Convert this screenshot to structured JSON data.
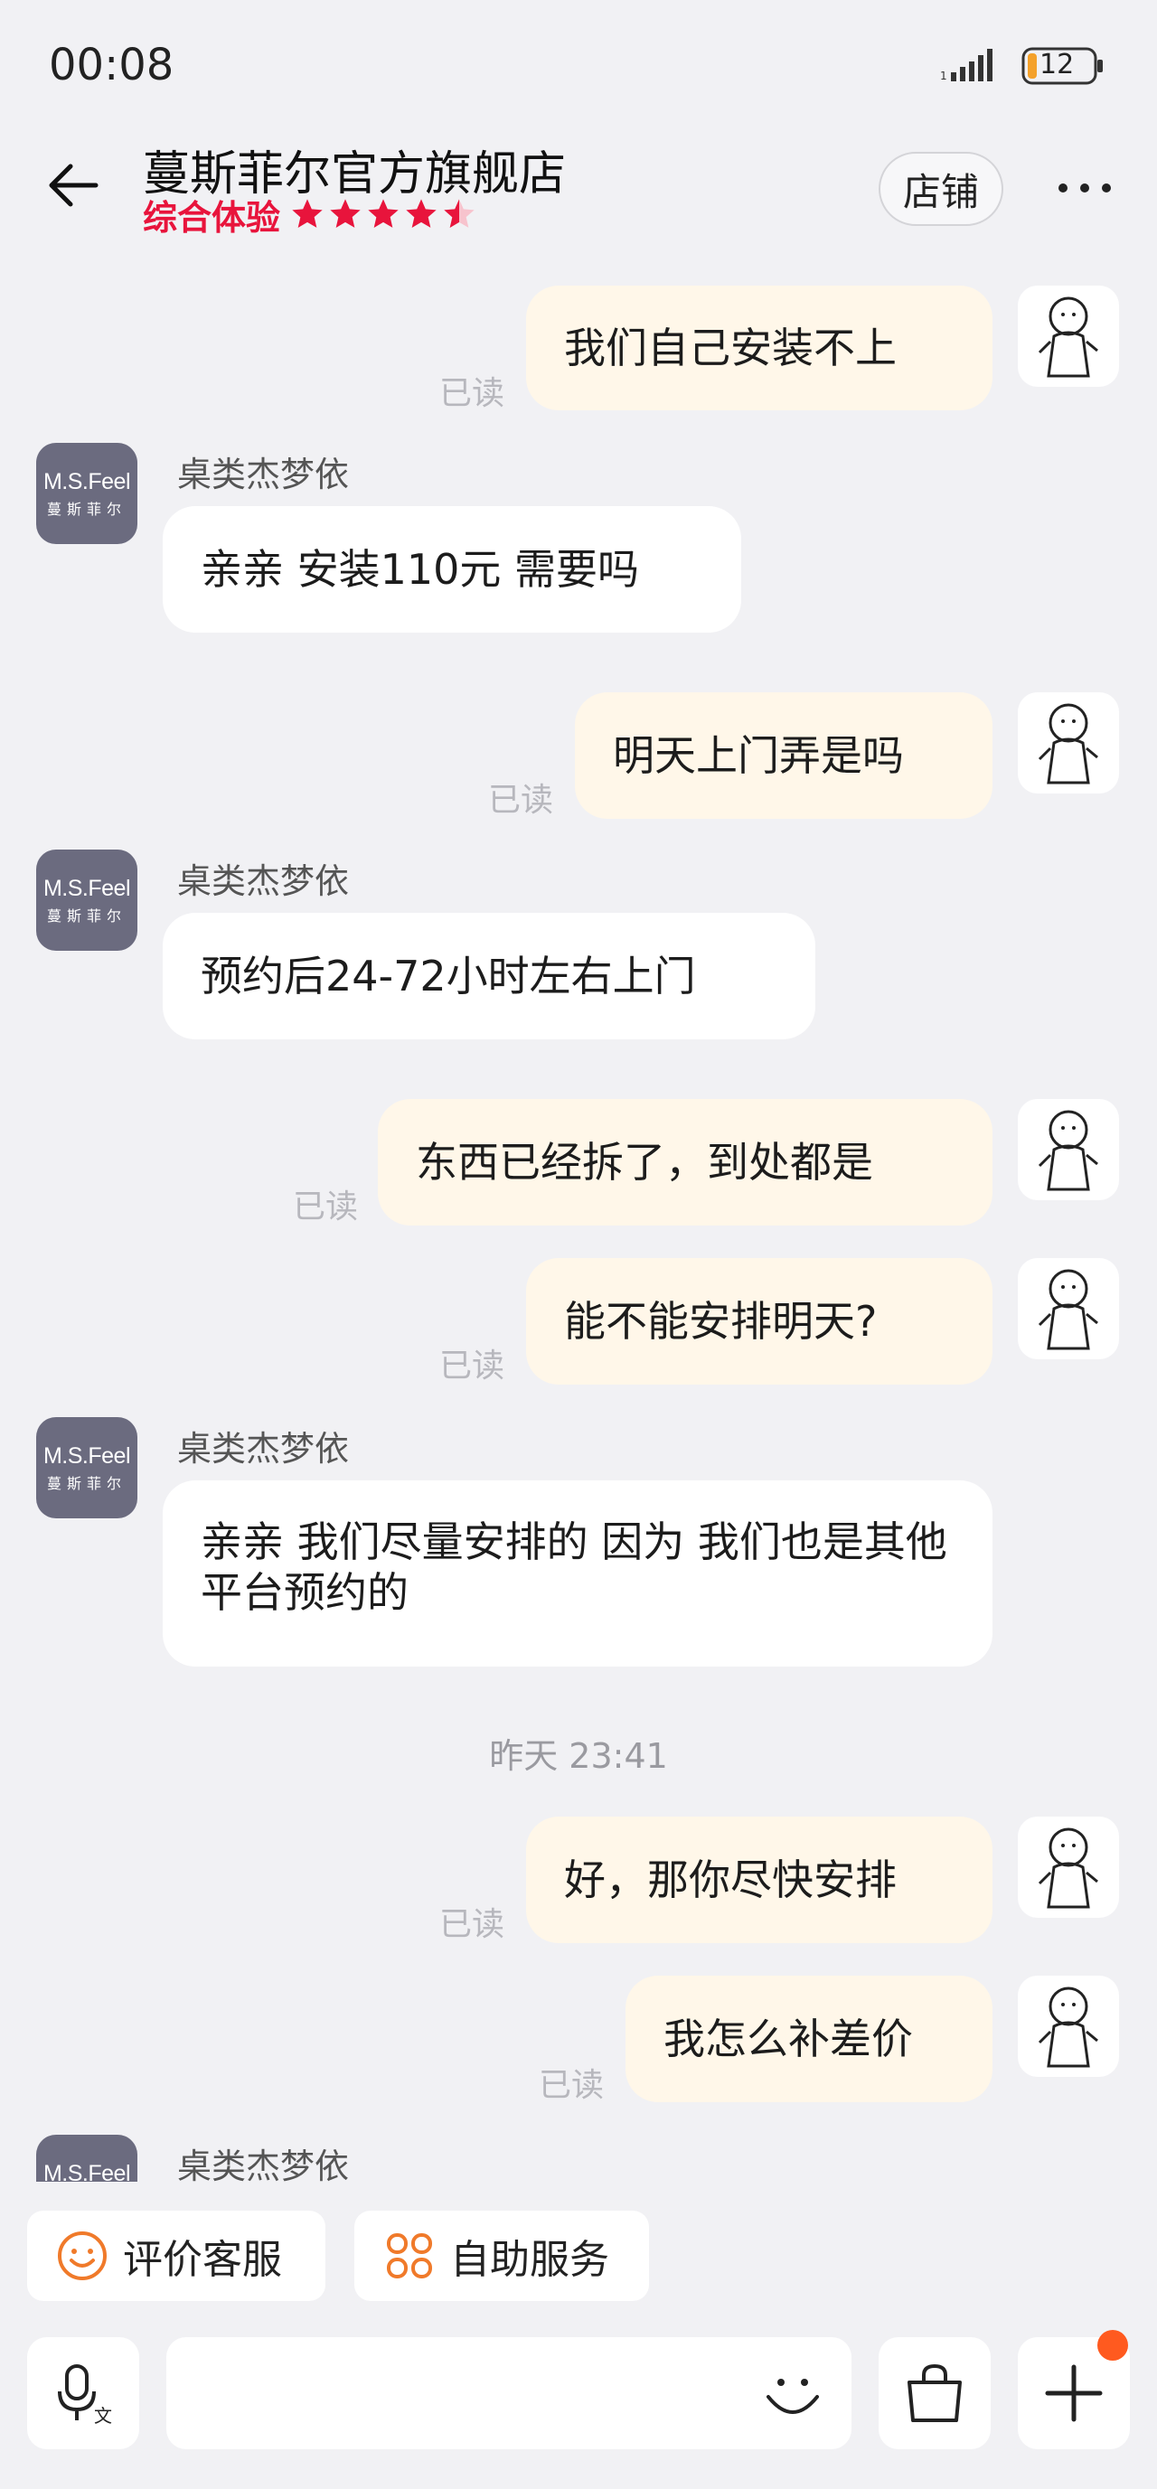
{
  "status_bar": {
    "time": "00:08",
    "battery": "12"
  },
  "header": {
    "title": "蔓斯菲尔官方旗舰店",
    "rating_label": "综合体验",
    "rating_stars": 4.5,
    "shop_button": "店铺"
  },
  "avatar": {
    "brand": "M.S.Feel",
    "brand_cn": "蔓斯菲尔"
  },
  "read_label": "已读",
  "messages": [
    {
      "from": "me",
      "text": "我们自己安装不上"
    },
    {
      "from": "them",
      "sender": "桌类杰梦依",
      "text": "亲亲 安装110元 需要吗"
    },
    {
      "from": "me",
      "text": "明天上门弄是吗"
    },
    {
      "from": "them",
      "sender": "桌类杰梦依",
      "text": "预约后24-72小时左右上门"
    },
    {
      "from": "me",
      "text": "东西已经拆了，到处都是"
    },
    {
      "from": "me",
      "text": "能不能安排明天?"
    },
    {
      "from": "them",
      "sender": "桌类杰梦依",
      "text": "亲亲 我们尽量安排的 因为 我们也是其他平台预约的"
    },
    {
      "from": "me",
      "text": "好，那你尽快安排"
    },
    {
      "from": "me",
      "text": "我怎么补差价"
    },
    {
      "from": "them",
      "sender": "桌类杰梦依",
      "text": ""
    }
  ],
  "timestamp": "昨天  23:41",
  "quick_actions": [
    "评价客服",
    "自助服务"
  ],
  "colors": {
    "accent_red": "#e8143c",
    "my_bubble": "#fff7e9",
    "orange": "#ff5a1f"
  }
}
